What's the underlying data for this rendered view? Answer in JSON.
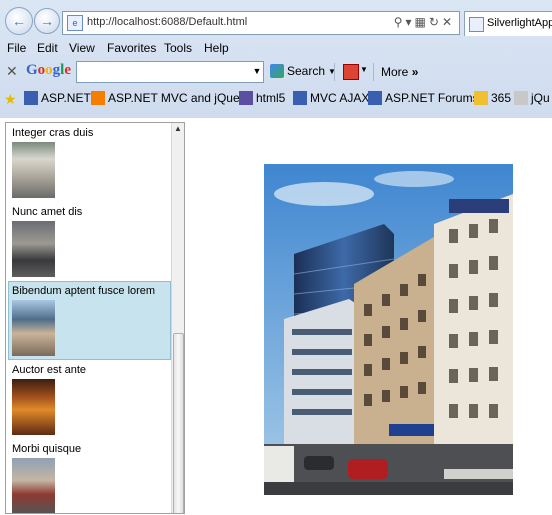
{
  "browser": {
    "url": "http://localhost:6088/Default.html",
    "tab_title": "SilverlightApp",
    "menu": [
      "File",
      "Edit",
      "View",
      "Favorites",
      "Tools",
      "Help"
    ],
    "google_toolbar": {
      "logo": "Google",
      "search_label": "Search",
      "more_label": "More"
    },
    "favorites": [
      {
        "label": "ASP.NET",
        "icon": "aspnet-icon"
      },
      {
        "label": "ASP.NET MVC and jQuery",
        "icon": "blogger-icon"
      },
      {
        "label": "html5",
        "icon": "html5-icon"
      },
      {
        "label": "MVC AJAX",
        "icon": "aspnet-icon"
      },
      {
        "label": "ASP.NET Forums",
        "icon": "aspnet-icon"
      },
      {
        "label": "365",
        "icon": "ie-icon"
      },
      {
        "label": "jQu",
        "icon": "dp-icon"
      }
    ]
  },
  "list": {
    "items": [
      {
        "label": "Integer cras duis",
        "selected": false
      },
      {
        "label": "Nunc amet dis",
        "selected": false
      },
      {
        "label": "Bibendum aptent fusce lorem",
        "selected": true
      },
      {
        "label": "Auctor est ante",
        "selected": false
      },
      {
        "label": "Morbi quisque",
        "selected": false
      }
    ]
  },
  "colors": {
    "selection_bg": "#c7e3ee",
    "chrome_bg": "#dbe6f4"
  }
}
